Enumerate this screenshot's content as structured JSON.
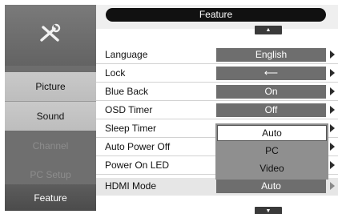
{
  "header": {
    "title": "Feature",
    "scroll_up": "▲",
    "scroll_down": "▼"
  },
  "sidebar": {
    "icon": "tools-icon",
    "items": [
      {
        "label": "Picture",
        "state": "normal"
      },
      {
        "label": "Sound",
        "state": "normal"
      },
      {
        "label": "Channel",
        "state": "disabled"
      },
      {
        "label": "PC Setup",
        "state": "disabled"
      },
      {
        "label": "Feature",
        "state": "active"
      }
    ]
  },
  "menu": [
    {
      "label": "Language",
      "value": "English"
    },
    {
      "label": "Lock",
      "value": "⟵"
    },
    {
      "label": "Blue Back",
      "value": "On"
    },
    {
      "label": "OSD Timer",
      "value": "Off"
    },
    {
      "label": "Sleep Timer",
      "value": ""
    },
    {
      "label": "Auto Power Off",
      "value": ""
    },
    {
      "label": "Power On LED",
      "value": ""
    },
    {
      "label": "HDMI Mode",
      "value": "Auto"
    }
  ],
  "dropdown": {
    "options": [
      "Auto",
      "PC",
      "Video"
    ],
    "selected": "Auto"
  },
  "colors": {
    "sidebar": "#6d6d6d",
    "value_box": "#6e6e6e",
    "header": "#111111",
    "active_item": "#4b4b4b"
  }
}
